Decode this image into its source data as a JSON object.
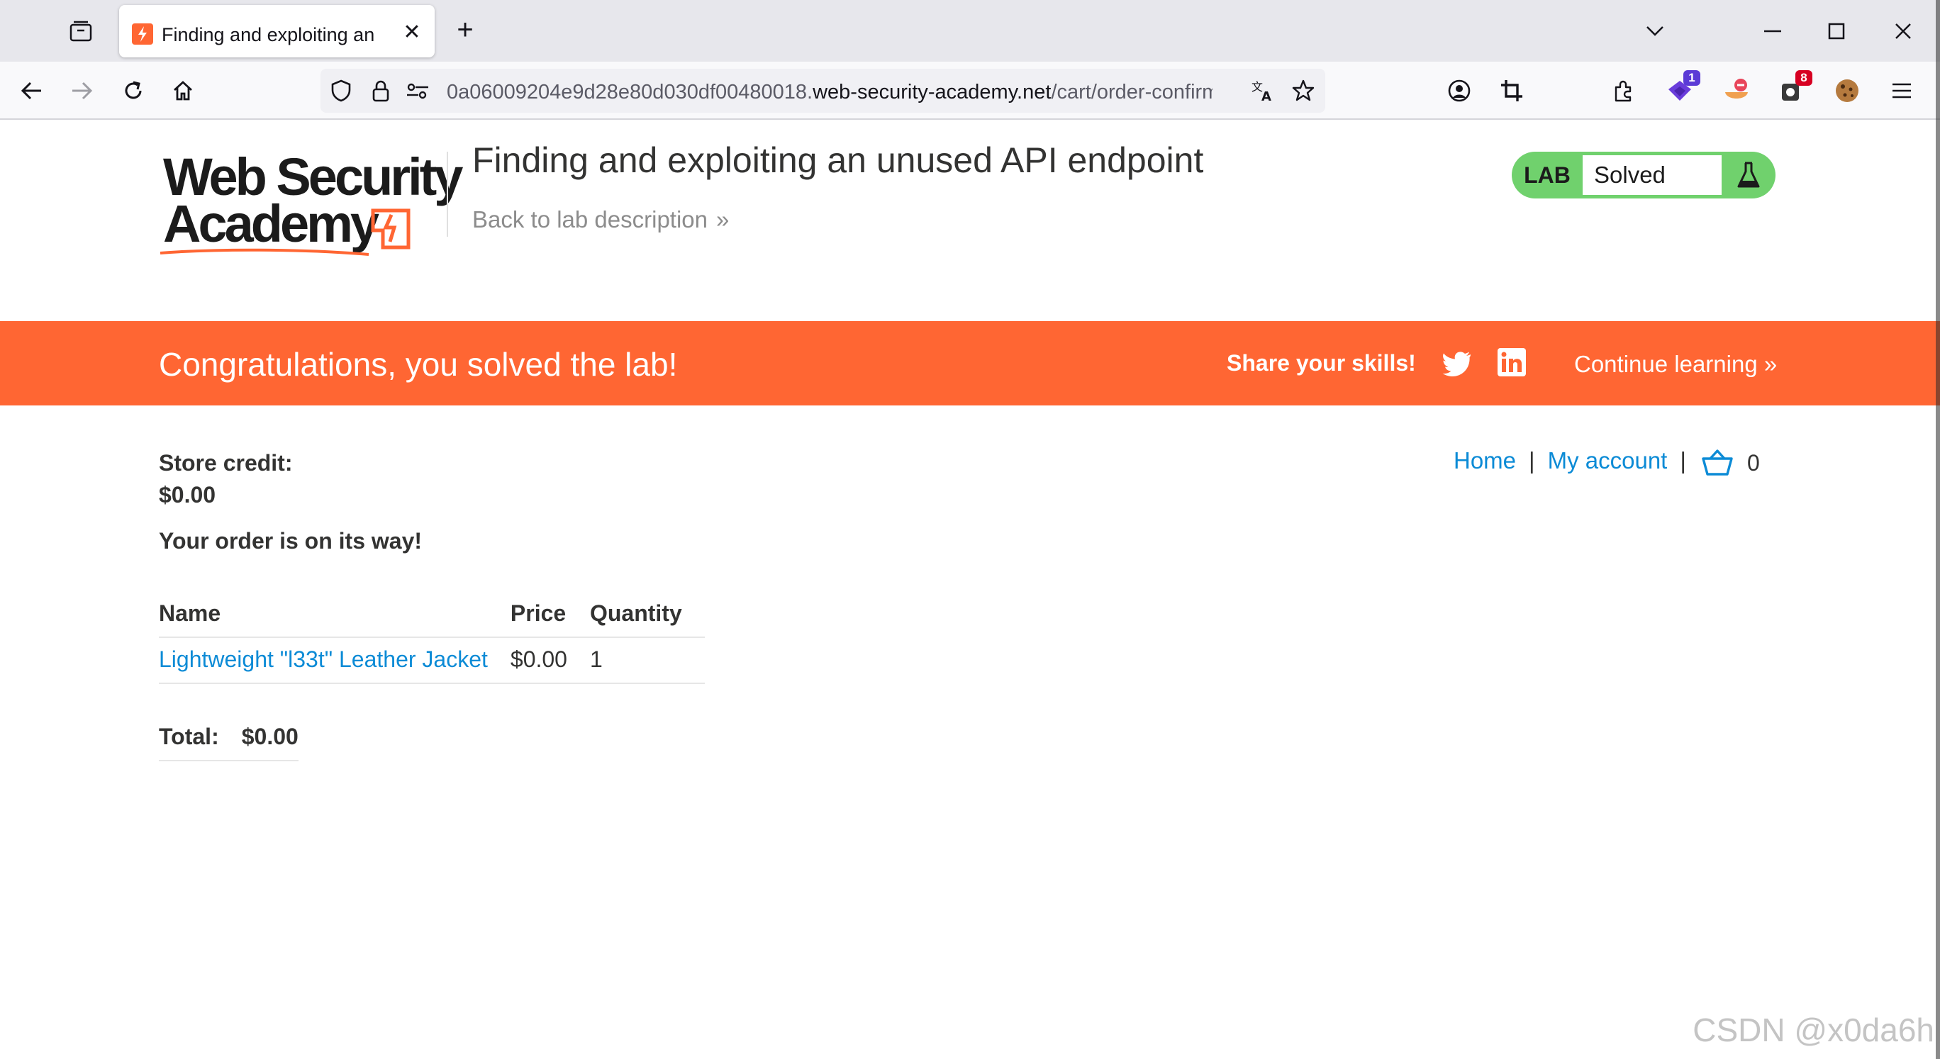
{
  "browser": {
    "tab_title": "Finding and exploiting an unused API endpoint",
    "url_prefix": "0a06009204e9d28e80d030df00480018.",
    "url_host": "web-security-academy.net",
    "url_path": "/cart/order-confirmation?order-confirmed=true",
    "extensions": [
      {
        "name": "extension-purple",
        "badge": "1",
        "badge_color": "#5b3bd6"
      },
      {
        "name": "extension-cookie-block",
        "badge": "",
        "badge_color": ""
      },
      {
        "name": "extension-counter",
        "badge": "8",
        "badge_color": "#d70022"
      },
      {
        "name": "cookie-editor-extension",
        "badge": "",
        "badge_color": ""
      }
    ]
  },
  "header": {
    "logo_line1": "Web Security",
    "logo_line2": "Academy",
    "lab_title": "Finding and exploiting an unused API endpoint",
    "back_link": "Back to lab description",
    "lab_badge_label": "LAB",
    "lab_status": "Solved"
  },
  "banner": {
    "message": "Congratulations, you solved the lab!",
    "share": "Share your skills!",
    "continue": "Continue learning"
  },
  "nav": {
    "home": "Home",
    "separator": "|",
    "my_account": "My account",
    "cart_count": "0"
  },
  "store": {
    "credit_label": "Store credit:",
    "credit_value": "$0.00",
    "order_message": "Your order is on its way!"
  },
  "order_table": {
    "headers": [
      "Name",
      "Price",
      "Quantity"
    ],
    "rows": [
      {
        "name": "Lightweight \"l33t\" Leather Jacket",
        "price": "$0.00",
        "quantity": "1"
      }
    ]
  },
  "total": {
    "label": "Total:",
    "value": "$0.00"
  },
  "watermark": "CSDN @x0da6h",
  "colors": {
    "brand_orange": "#ff6633",
    "link_blue": "#0c8bd6",
    "lab_green": "#70d16d"
  }
}
